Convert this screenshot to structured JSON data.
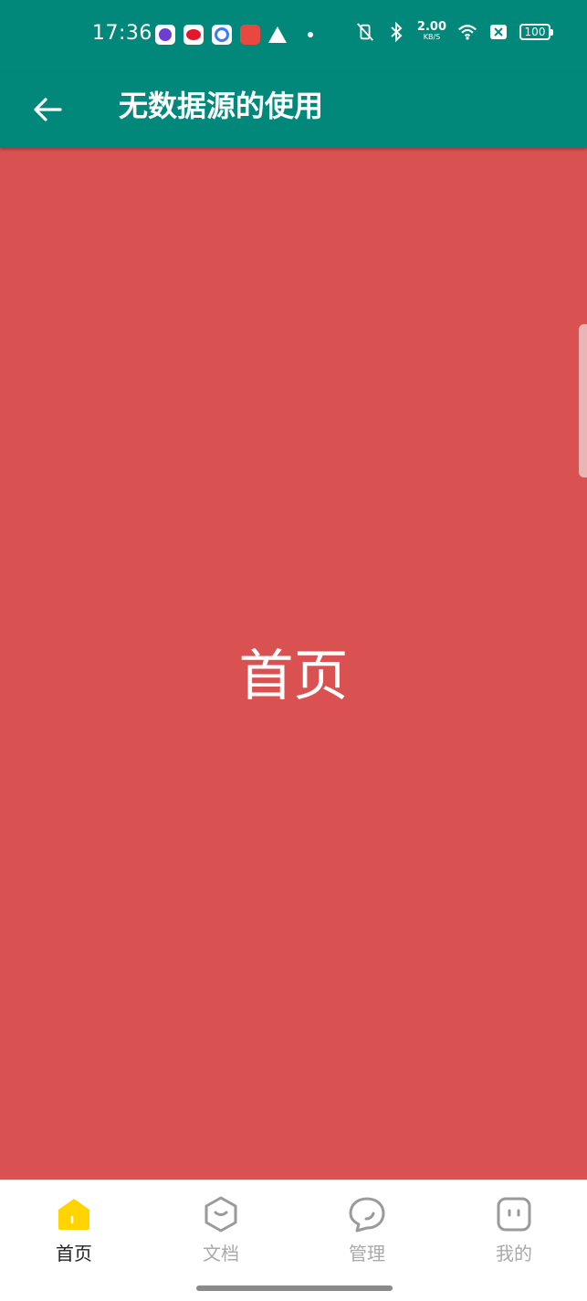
{
  "status_bar": {
    "time": "17:36",
    "net_speed_value": "2.00",
    "net_speed_unit": "KB/S",
    "battery": "100",
    "notification_icons": [
      "qq-icon",
      "weibo-icon",
      "baidu-icon",
      "pig-app-icon",
      "warning-icon",
      "dot-icon"
    ],
    "system_icons": [
      "mute-vibrate-icon",
      "bluetooth-icon",
      "wifi-icon",
      "sim-icon",
      "battery-icon"
    ]
  },
  "app_bar": {
    "title": "无数据源的使用",
    "back_icon": "arrow-left-icon",
    "background": "#02887a"
  },
  "content": {
    "text": "首页",
    "background": "#d95251"
  },
  "bottom_nav": {
    "items": [
      {
        "label": "首页",
        "icon": "home-icon",
        "active": true
      },
      {
        "label": "文档",
        "icon": "hexagon-smile-icon",
        "active": false
      },
      {
        "label": "管理",
        "icon": "chat-bubble-icon",
        "active": false
      },
      {
        "label": "我的",
        "icon": "face-icon",
        "active": false
      }
    ],
    "active_color": "#ffd400",
    "inactive_color": "#a9a9a9"
  }
}
